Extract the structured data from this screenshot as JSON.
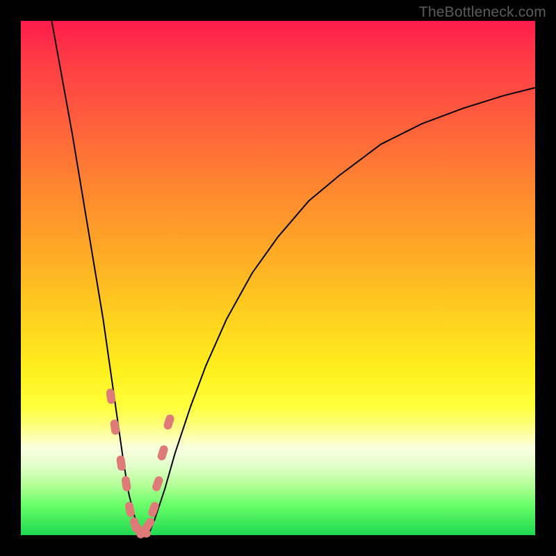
{
  "watermark": "TheBottleneck.com",
  "colors": {
    "frame": "#000000",
    "marker": "#de7b79",
    "curve": "#000000"
  },
  "chart_data": {
    "type": "line",
    "title": "",
    "xlabel": "",
    "ylabel": "",
    "xlim": [
      0,
      100
    ],
    "ylim": [
      0,
      100
    ],
    "note": "V-shaped bottleneck curve. x and y in percent of plot area (0 = left/bottom, 100 = right/top). Values estimated from pixels; no axis tick labels are shown in source image.",
    "series": [
      {
        "name": "bottleneck-curve",
        "x": [
          6,
          8,
          10,
          12,
          14,
          16,
          17,
          18,
          19,
          20,
          21,
          22,
          23,
          24,
          25,
          26,
          28,
          30,
          33,
          36,
          40,
          45,
          50,
          56,
          62,
          70,
          78,
          86,
          94,
          100
        ],
        "y": [
          100,
          89,
          78,
          66,
          54,
          42,
          35,
          28,
          21,
          14,
          8,
          4,
          1,
          0,
          0.5,
          3,
          9,
          16,
          25,
          33,
          42,
          51,
          58,
          65,
          70,
          76,
          80,
          83,
          85.5,
          87
        ]
      }
    ],
    "markers": {
      "name": "highlighted-points",
      "shape": "rounded-capsule",
      "x": [
        17.5,
        18.3,
        19.5,
        20.5,
        21.2,
        22.2,
        23.0,
        23.8,
        24.8,
        25.8,
        26.6,
        27.6,
        28.8
      ],
      "y": [
        27,
        21,
        14,
        10,
        5,
        2,
        0.8,
        0.5,
        2,
        5,
        10,
        16,
        22
      ]
    }
  }
}
